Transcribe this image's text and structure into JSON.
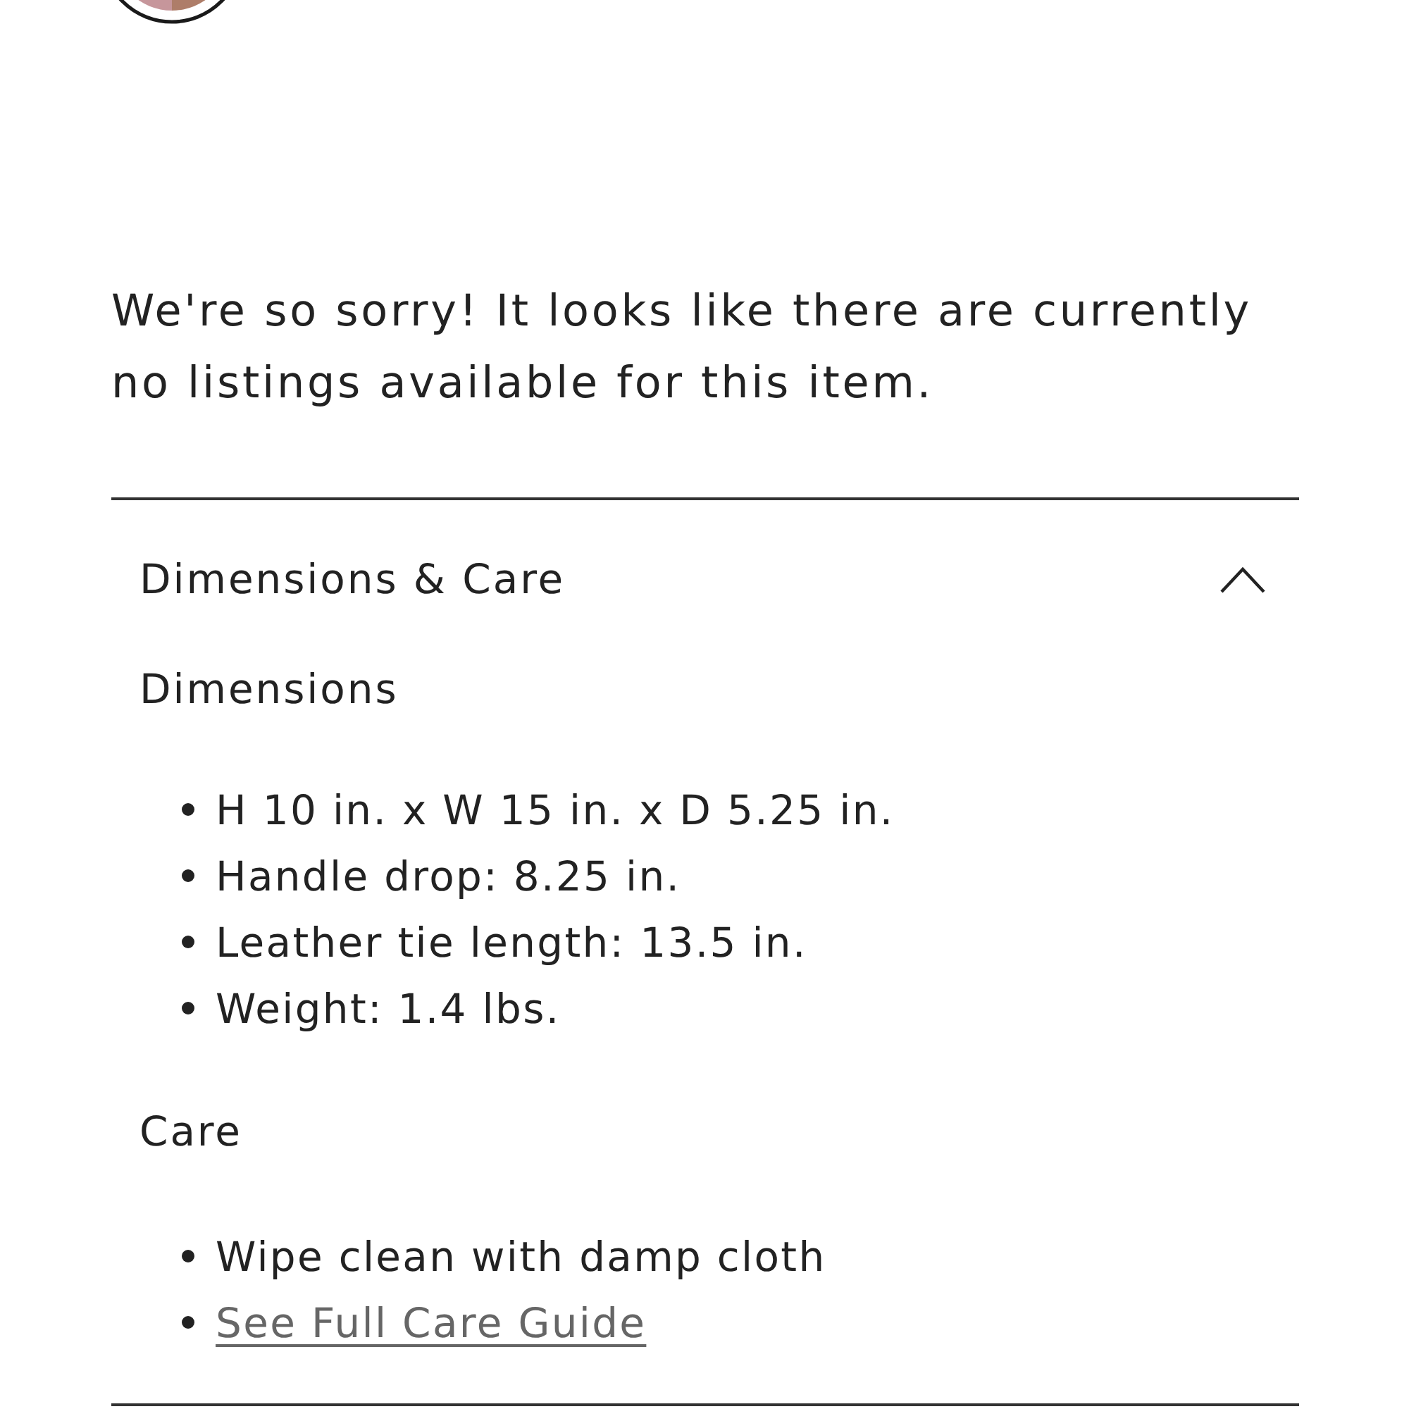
{
  "swatch": {
    "selected": true,
    "halves": [
      {
        "color": "#c6969b"
      },
      {
        "color": "#ae7d69"
      }
    ]
  },
  "message": "We're so sorry! It looks like there are currently no listings available for this item.",
  "accordion": {
    "title": "Dimensions & Care",
    "expanded": true,
    "sections": [
      {
        "heading": "Dimensions",
        "items": [
          {
            "kind": "text",
            "text": "H 10 in. x W 15 in. x D 5.25 in."
          },
          {
            "kind": "text",
            "text": "Handle drop: 8.25 in."
          },
          {
            "kind": "text",
            "text": "Leather tie length: 13.5 in."
          },
          {
            "kind": "text",
            "text": "Weight: 1.4 lbs."
          }
        ]
      },
      {
        "heading": "Care",
        "items": [
          {
            "kind": "text",
            "text": "Wipe clean with damp cloth"
          },
          {
            "kind": "link",
            "text": "See Full Care Guide"
          }
        ]
      }
    ]
  }
}
